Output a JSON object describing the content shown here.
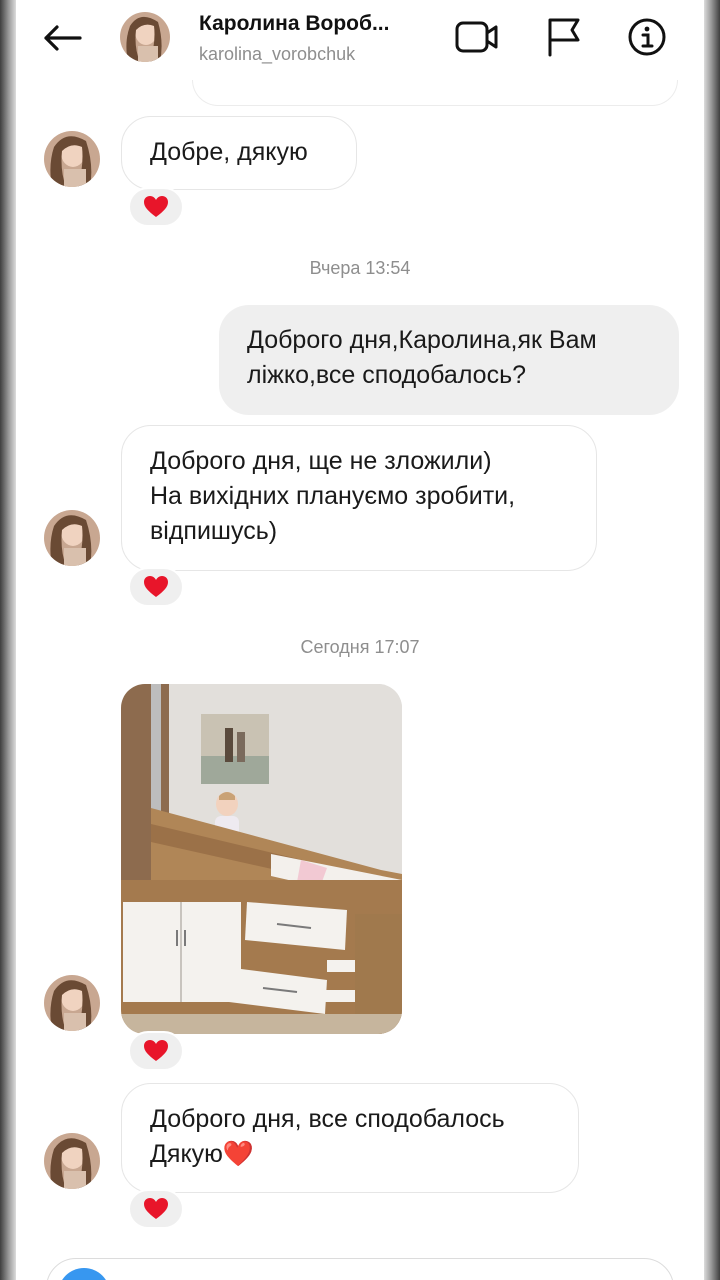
{
  "header": {
    "title": "Каролина Вороб...",
    "username": "karolina_vorobchuk",
    "back_icon": "arrow-left-icon",
    "video_icon": "video-camera-icon",
    "flag_icon": "flag-icon",
    "info_icon": "info-icon"
  },
  "messages": [
    {
      "direction": "in",
      "text": "Добре, дякую",
      "reaction": "heart"
    },
    {
      "type": "timestamp",
      "text": "Вчера 13:54"
    },
    {
      "direction": "out",
      "lines": [
        "Доброго дня,Каролина,як Вам",
        "ліжко,все сподобалось?"
      ]
    },
    {
      "direction": "in",
      "lines": [
        "Доброго дня, ще не зложили)",
        "На вихідних плануємо зробити,",
        "відпишусь)"
      ],
      "reaction": "heart"
    },
    {
      "type": "timestamp",
      "text": "Сегодня 17:07"
    },
    {
      "direction": "in",
      "type": "photo",
      "reaction": "heart"
    },
    {
      "direction": "in",
      "lines": [
        "Доброго дня, все сподобалось",
        "Дякую❤️"
      ],
      "reaction": "heart"
    }
  ],
  "colors": {
    "heart": "#e8152a",
    "accent": "#3797f0",
    "outgoing_bubble": "#efefef",
    "muted_text": "#8e8e8e"
  }
}
